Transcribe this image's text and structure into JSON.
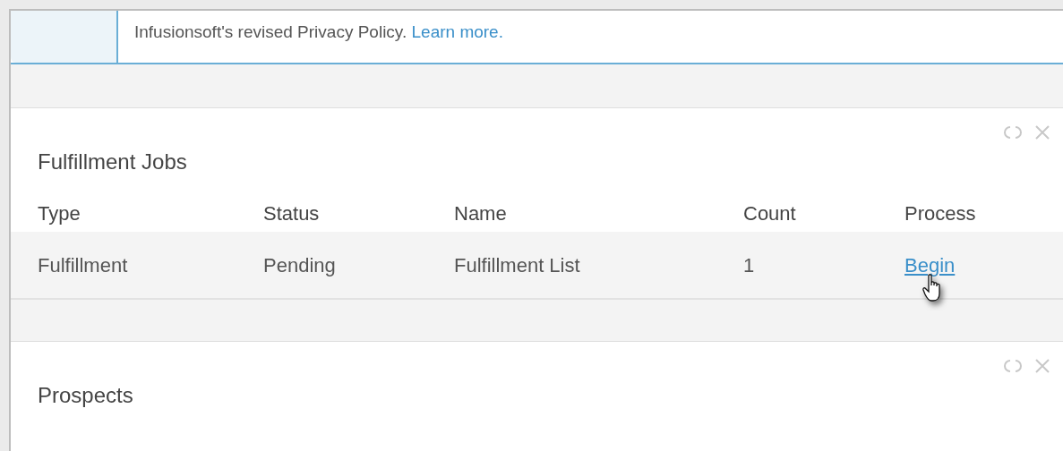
{
  "notice": {
    "text": "Infusionsoft's revised Privacy Policy.",
    "link": "Learn more."
  },
  "panels": [
    {
      "title": "Fulfillment Jobs",
      "columns": [
        "Type",
        "Status",
        "Name",
        "Count",
        "Process"
      ],
      "rows": [
        {
          "cells": [
            "Fulfillment",
            "Pending",
            "Fulfillment List",
            "1"
          ],
          "action": "Begin",
          "hovered": true
        }
      ]
    },
    {
      "title": "Prospects"
    }
  ]
}
